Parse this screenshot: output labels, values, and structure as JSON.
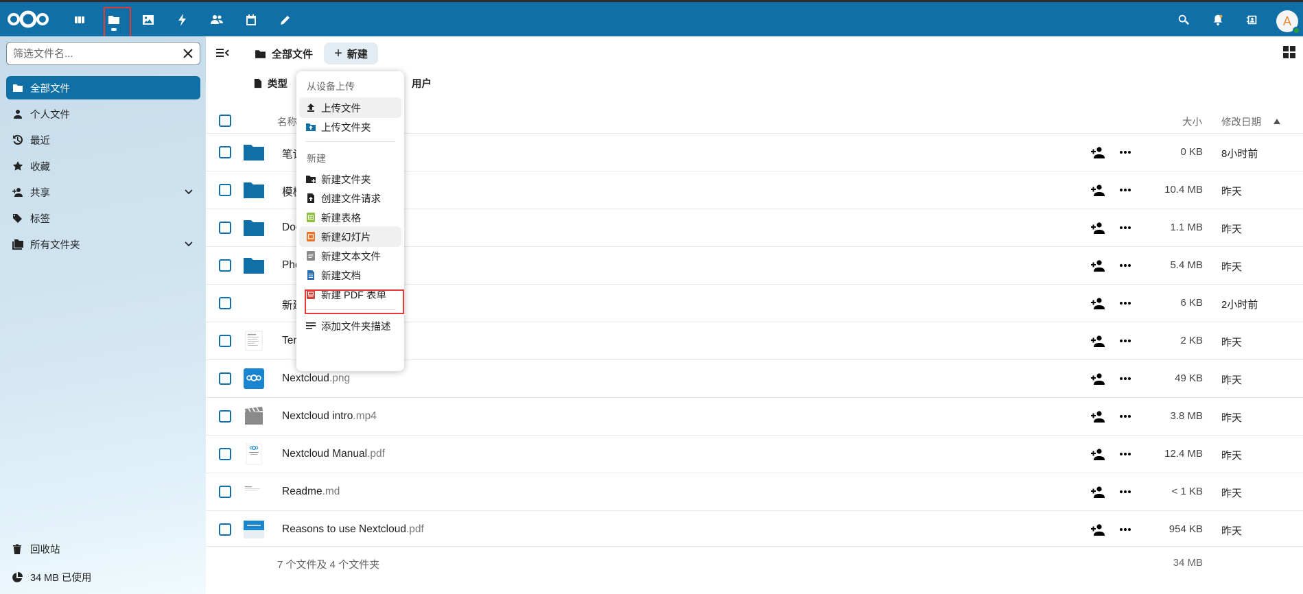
{
  "topbar": {
    "apps": [
      {
        "name": "dashboard",
        "icon": "dashboard-icon"
      },
      {
        "name": "files",
        "icon": "folder-icon",
        "active": true
      },
      {
        "name": "photos",
        "icon": "image-icon"
      },
      {
        "name": "activity",
        "icon": "lightning-icon"
      },
      {
        "name": "contacts",
        "icon": "people-icon"
      },
      {
        "name": "calendar",
        "icon": "calendar-icon"
      },
      {
        "name": "notes",
        "icon": "pencil-icon"
      }
    ],
    "avatar_letter": "A",
    "brand_color": "#0f6fa6"
  },
  "sidebar": {
    "filter_placeholder": "筛选文件名...",
    "items": [
      {
        "label": "全部文件",
        "icon": "folder-icon",
        "active": true
      },
      {
        "label": "个人文件",
        "icon": "person-icon"
      },
      {
        "label": "最近",
        "icon": "history-icon"
      },
      {
        "label": "收藏",
        "icon": "star-icon"
      },
      {
        "label": "共享",
        "icon": "share-icon",
        "expandable": true
      },
      {
        "label": "标签",
        "icon": "tag-icon"
      },
      {
        "label": "所有文件夹",
        "icon": "folders-icon",
        "expandable": true
      }
    ],
    "trash_label": "回收站",
    "quota_label": "34 MB 已使用"
  },
  "main": {
    "breadcrumb": "全部文件",
    "new_button": "新建",
    "filters": {
      "type": "类型",
      "people": "用户"
    },
    "columns": {
      "name": "名称",
      "size": "大小",
      "modified": "修改日期"
    },
    "rows": [
      {
        "name": "笔记",
        "ext": "",
        "kind": "folder",
        "size": "0 KB",
        "modified": "8小时前"
      },
      {
        "name": "模板",
        "ext": "",
        "kind": "folder",
        "size": "10.4 MB",
        "modified": "昨天"
      },
      {
        "name": "Documents",
        "ext": "",
        "kind": "folder",
        "size": "1.1 MB",
        "modified": "昨天"
      },
      {
        "name": "Photos",
        "ext": "",
        "kind": "folder",
        "size": "5.4 MB",
        "modified": "昨天"
      },
      {
        "name": "新建文档",
        "ext": "",
        "kind": "doc-blank",
        "size": "6 KB",
        "modified": "2小时前"
      },
      {
        "name": "Templates",
        "ext": "",
        "kind": "doc-preview",
        "size": "2 KB",
        "modified": "昨天"
      },
      {
        "name": "Nextcloud",
        "ext": ".png",
        "kind": "png",
        "size": "49 KB",
        "modified": "昨天"
      },
      {
        "name": "Nextcloud intro",
        "ext": ".mp4",
        "kind": "video",
        "size": "3.8 MB",
        "modified": "昨天"
      },
      {
        "name": "Nextcloud Manual",
        "ext": ".pdf",
        "kind": "pdf-manual",
        "size": "12.4 MB",
        "modified": "昨天"
      },
      {
        "name": "Readme",
        "ext": ".md",
        "kind": "md",
        "size": "< 1 KB",
        "modified": "昨天"
      },
      {
        "name": "Reasons to use Nextcloud",
        "ext": ".pdf",
        "kind": "pdf-reasons",
        "size": "954 KB",
        "modified": "昨天"
      }
    ],
    "summary": "7 个文件及 4 个文件夹",
    "total_size": "34 MB"
  },
  "new_menu": {
    "upload_caption": "从设备上传",
    "upload_items": [
      {
        "label": "上传文件",
        "icon": "upload-icon"
      },
      {
        "label": "上传文件夹",
        "icon": "upload-folder-icon"
      }
    ],
    "new_caption": "新建",
    "new_items": [
      {
        "label": "新建文件夹",
        "icon": "folder-plus-icon"
      },
      {
        "label": "创建文件请求",
        "icon": "file-request-icon"
      },
      {
        "label": "新建表格",
        "icon": "spreadsheet-icon"
      },
      {
        "label": "新建幻灯片",
        "icon": "presentation-icon"
      },
      {
        "label": "新建文本文件",
        "icon": "text-file-icon"
      },
      {
        "label": "新建文档",
        "icon": "document-icon"
      },
      {
        "label": "新建 PDF 表单",
        "icon": "pdf-form-icon"
      }
    ],
    "extra_items": [
      {
        "label": "添加文件夹描述",
        "icon": "description-icon"
      }
    ]
  },
  "colors": {
    "accent": "#0f6fa6",
    "highlight": "#e53935",
    "folder": "#0f6fa6"
  }
}
